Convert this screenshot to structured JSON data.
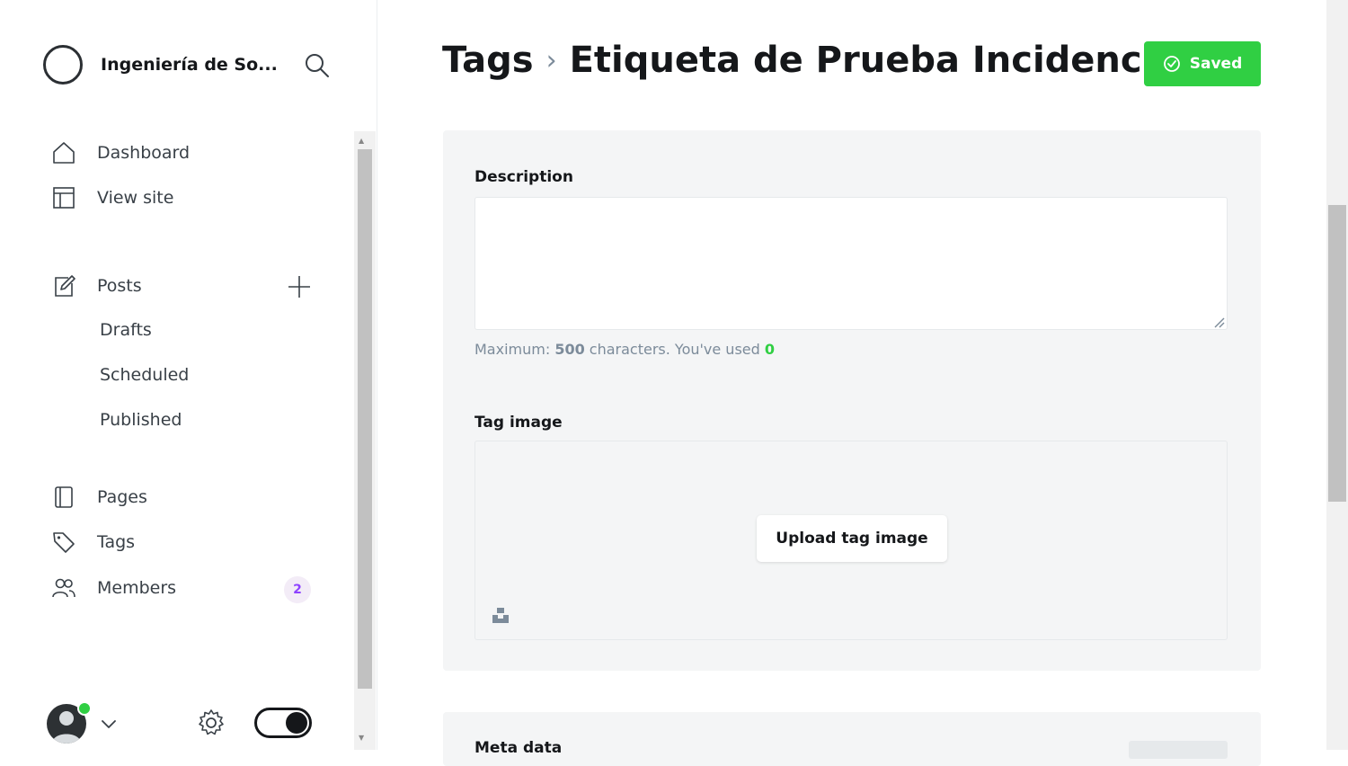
{
  "site": {
    "title": "Ingeniería de So..."
  },
  "nav": {
    "dashboard": "Dashboard",
    "view_site": "View site",
    "posts": "Posts",
    "drafts": "Drafts",
    "scheduled": "Scheduled",
    "published": "Published",
    "pages": "Pages",
    "tags": "Tags",
    "members": "Members",
    "members_count": "2"
  },
  "header": {
    "crumb_parent": "Tags",
    "crumb_separator": "›",
    "crumb_current": "Etiqueta de Prueba Incidencia",
    "saved_label": "Saved"
  },
  "form": {
    "description_label": "Description",
    "description_value": "",
    "hint_prefix": "Maximum: ",
    "hint_max": "500",
    "hint_suffix": " characters. You've used ",
    "hint_used": "0",
    "tag_image_label": "Tag image",
    "upload_label": "Upload tag image",
    "meta_label": "Meta data"
  },
  "colors": {
    "accent": "#30cf43",
    "members_badge": "#8e42ff"
  },
  "icons": [
    "site-logo",
    "search-icon",
    "home-icon",
    "view-site-icon",
    "posts-icon",
    "plus-icon",
    "pages-icon",
    "tag-icon",
    "members-icon",
    "chevron-down-icon",
    "gear-icon",
    "check-circle-icon",
    "unsplash-icon"
  ]
}
